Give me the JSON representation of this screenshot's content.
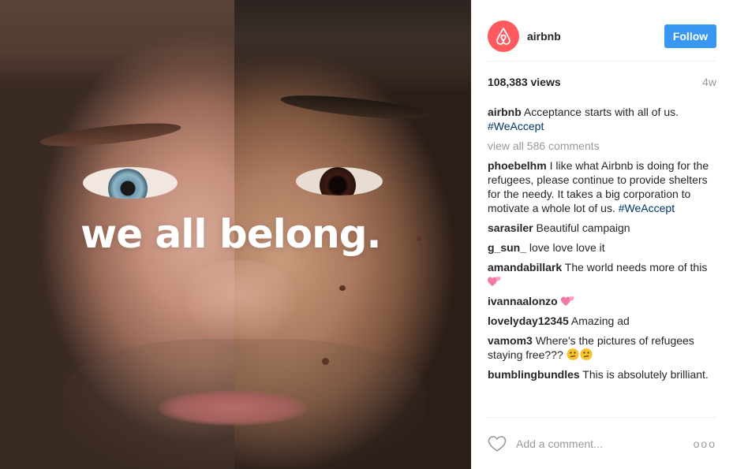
{
  "media": {
    "headline": "we all belong."
  },
  "header": {
    "avatar_icon": "airbnb-logo-icon",
    "username": "airbnb",
    "follow_label": "Follow",
    "brand_color": "#ff5a5f",
    "button_color": "#3897f0"
  },
  "stats": {
    "views": "108,383 views",
    "age": "4w"
  },
  "caption": {
    "user": "airbnb",
    "text": "Acceptance starts with all of us.",
    "hashtag": "#WeAccept"
  },
  "view_all": "view all 586 comments",
  "comments": [
    {
      "user": "phoebelhm",
      "text": "I like what Airbnb is doing for the refugees, please continue to provide shelters for the needy. It takes a big corporation to motivate a whole lot of us.",
      "hashtag": "#WeAccept"
    },
    {
      "user": "sarasiler",
      "text": "Beautiful campaign"
    },
    {
      "user": "g_sun_",
      "text": "love love love it"
    },
    {
      "user": "amandabillark",
      "text": "The world needs more of this",
      "emoji": "two-hearts-emoji"
    },
    {
      "user": "ivannaalonzo",
      "text": "",
      "emoji": "two-hearts-emoji"
    },
    {
      "user": "lovelyday12345",
      "text": "Amazing ad"
    },
    {
      "user": "vamom3",
      "text": "Where's the pictures of refugees staying free???",
      "emoji": "thinking-face-emoji"
    },
    {
      "user": "bumblingbundles",
      "text": "This is absolutely brilliant."
    }
  ],
  "footer": {
    "like_icon": "heart-icon",
    "comment_placeholder": "Add a comment...",
    "more_label": "ooo"
  }
}
